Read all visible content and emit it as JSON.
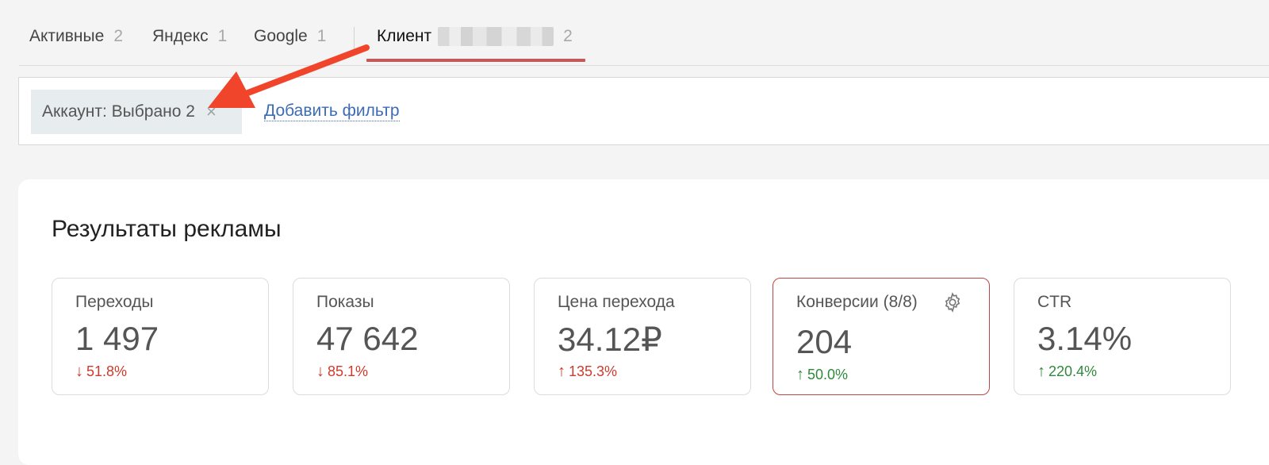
{
  "tabs": [
    {
      "label": "Активные",
      "count": "2"
    },
    {
      "label": "Яндекс",
      "count": "1"
    },
    {
      "label": "Google",
      "count": "1"
    },
    {
      "label": "Клиент",
      "count": "2"
    }
  ],
  "filter": {
    "chip_label": "Аккаунт: Выбрано 2",
    "close_symbol": "×",
    "add_filter": "Добавить фильтр"
  },
  "results": {
    "title": "Результаты рекламы",
    "metrics": [
      {
        "label": "Переходы",
        "value": "1 497",
        "delta": "51.8%",
        "direction": "down",
        "arrow": "↓"
      },
      {
        "label": "Показы",
        "value": "47 642",
        "delta": "85.1%",
        "direction": "down",
        "arrow": "↓"
      },
      {
        "label": "Цена перехода",
        "value": "34.12₽",
        "delta": "135.3%",
        "direction": "up-bad",
        "arrow": "↑"
      },
      {
        "label": "Конверсии (8/8)",
        "value": "204",
        "delta": "50.0%",
        "direction": "up",
        "arrow": "↑"
      },
      {
        "label": "CTR",
        "value": "3.14%",
        "delta": "220.4%",
        "direction": "up",
        "arrow": "↑"
      }
    ]
  },
  "colors": {
    "accent": "#c55858",
    "link": "#3d6cb5",
    "negative": "#cc3b2e",
    "positive": "#2f8a3c",
    "annotation_arrow": "#f0452a"
  },
  "icons": {
    "settings": "gear-icon",
    "close": "close-icon",
    "annotation": "annotation-arrow"
  }
}
